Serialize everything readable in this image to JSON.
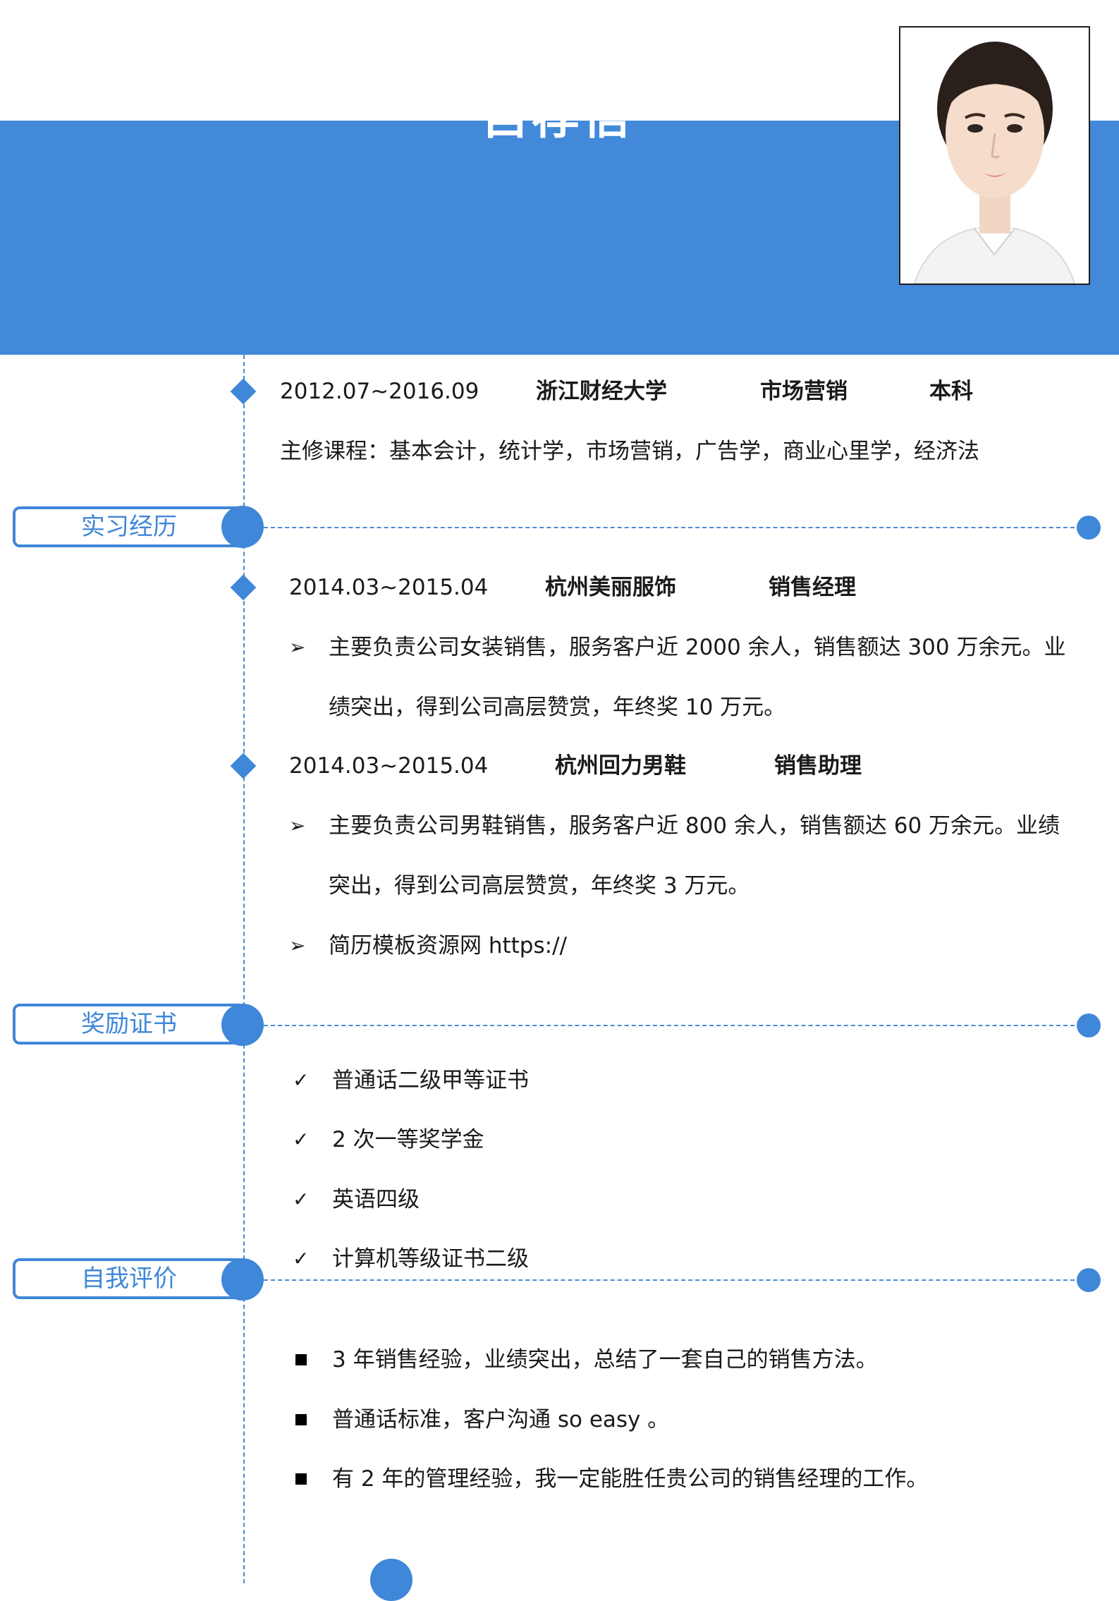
{
  "header": {
    "title": "自荐信"
  },
  "colors": {
    "accent": "#4289d9",
    "text": "#1a1a1a"
  },
  "education": {
    "period": "2012.07~2016.09",
    "school": "浙江财经大学",
    "major": "市场营销",
    "degree": "本科",
    "courses": "主修课程：基本会计，统计学，市场营销，广告学，商业心里学，经济法"
  },
  "sections": {
    "internship": "实习经历",
    "awards": "奖励证书",
    "self_eval": "自我评价"
  },
  "internships": [
    {
      "period": "2014.03~2015.04",
      "company": "杭州美丽服饰",
      "role": "销售经理",
      "line1": "主要负责公司女装销售，服务客户近 2000 余人，销售额达 300 万余元。业",
      "line2": "绩突出，得到公司高层赞赏，年终奖 10 万元。"
    },
    {
      "period": "2014.03~2015.04",
      "company": "杭州回力男鞋",
      "role": "销售助理",
      "line1": "主要负责公司男鞋销售，服务客户近 800 余人，销售额达 60 万余元。业绩",
      "line2": "突出，得到公司高层赞赏，年终奖 3 万元。",
      "extra": "简历模板资源网 https://"
    }
  ],
  "awards": [
    "普通话二级甲等证书",
    "2 次一等奖学金",
    "英语四级",
    "计算机等级证书二级"
  ],
  "self_eval": [
    "3 年销售经验，业绩突出，总结了一套自己的销售方法。",
    "普通话标准，客户沟通 so easy 。",
    "有 2 年的管理经验，我一定能胜任贵公司的销售经理的工作。"
  ],
  "icons": {
    "arrow": "arrow-bullet-icon",
    "check": "check-icon",
    "square": "square-bullet-icon"
  }
}
